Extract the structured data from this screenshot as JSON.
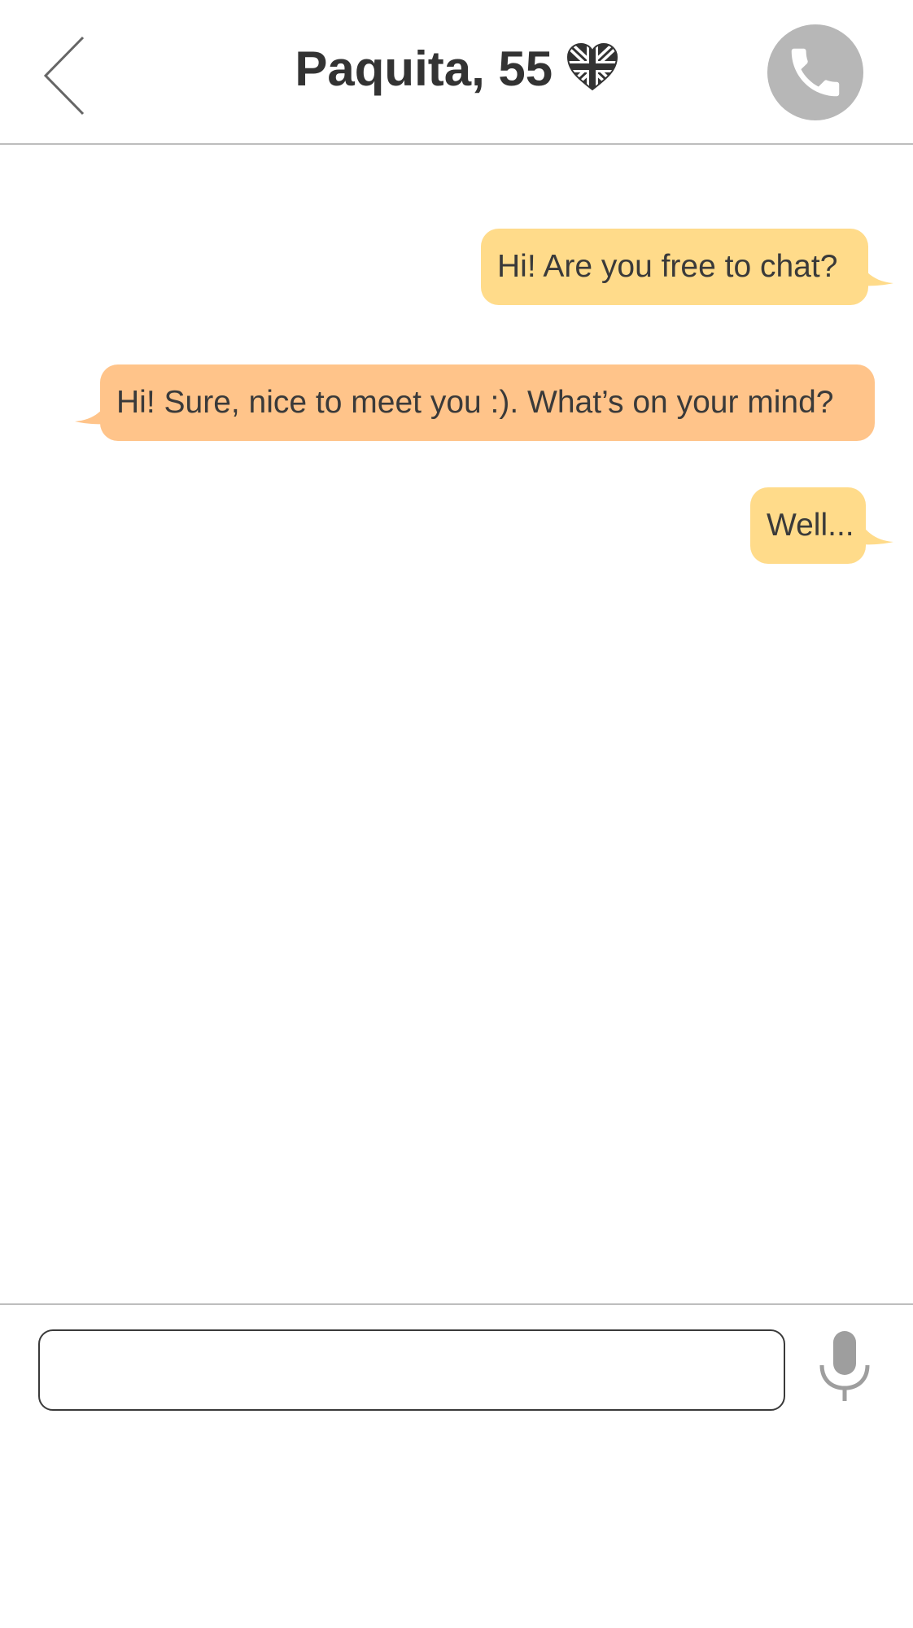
{
  "header": {
    "title": "Paquita, 55",
    "flag_icon": "uk-flag-heart-icon",
    "back_icon": "chevron-left-icon",
    "call_icon": "phone-icon"
  },
  "messages": [
    {
      "direction": "outgoing",
      "text": "Hi! Are you free to chat?"
    },
    {
      "direction": "incoming",
      "text": "Hi! Sure, nice to meet you :). What’s on your mind?"
    },
    {
      "direction": "outgoing",
      "text": "Well..."
    }
  ],
  "composer": {
    "value": "",
    "placeholder": "",
    "mic_icon": "microphone-icon"
  },
  "colors": {
    "outgoing_bubble": "#ffdb8a",
    "incoming_bubble": "#ffc48a",
    "call_button": "#b7b7b7",
    "divider": "#bdbdbd",
    "mic": "#9e9e9e"
  }
}
